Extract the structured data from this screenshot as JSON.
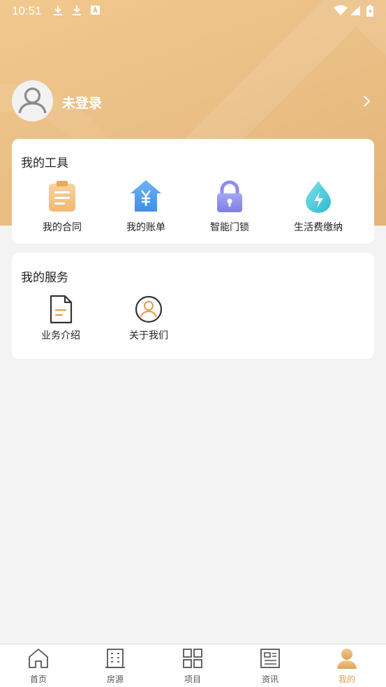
{
  "status_bar": {
    "time": "10:51"
  },
  "profile": {
    "name": "未登录"
  },
  "tools_card": {
    "title": "我的工具",
    "items": [
      {
        "label": "我的合同",
        "icon": "contract-clipboard-icon"
      },
      {
        "label": "我的账单",
        "icon": "bill-yen-house-icon"
      },
      {
        "label": "智能门锁",
        "icon": "smart-lock-icon"
      },
      {
        "label": "生活费缴纳",
        "icon": "utility-water-drop-icon"
      }
    ]
  },
  "services_card": {
    "title": "我的服务",
    "items": [
      {
        "label": "业务介绍",
        "icon": "document-icon"
      },
      {
        "label": "关于我们",
        "icon": "person-circle-icon"
      }
    ]
  },
  "tabbar": {
    "items": [
      {
        "label": "首页",
        "icon": "home-icon"
      },
      {
        "label": "房源",
        "icon": "building-icon"
      },
      {
        "label": "项目",
        "icon": "grid-icon"
      },
      {
        "label": "资讯",
        "icon": "news-icon"
      },
      {
        "label": "我的",
        "icon": "user-icon",
        "active": true
      }
    ]
  },
  "colors": {
    "header_gradient": "#ebc086",
    "accent": "#d8a055",
    "card_bg": "#ffffff",
    "page_bg": "#f3f3f3"
  }
}
